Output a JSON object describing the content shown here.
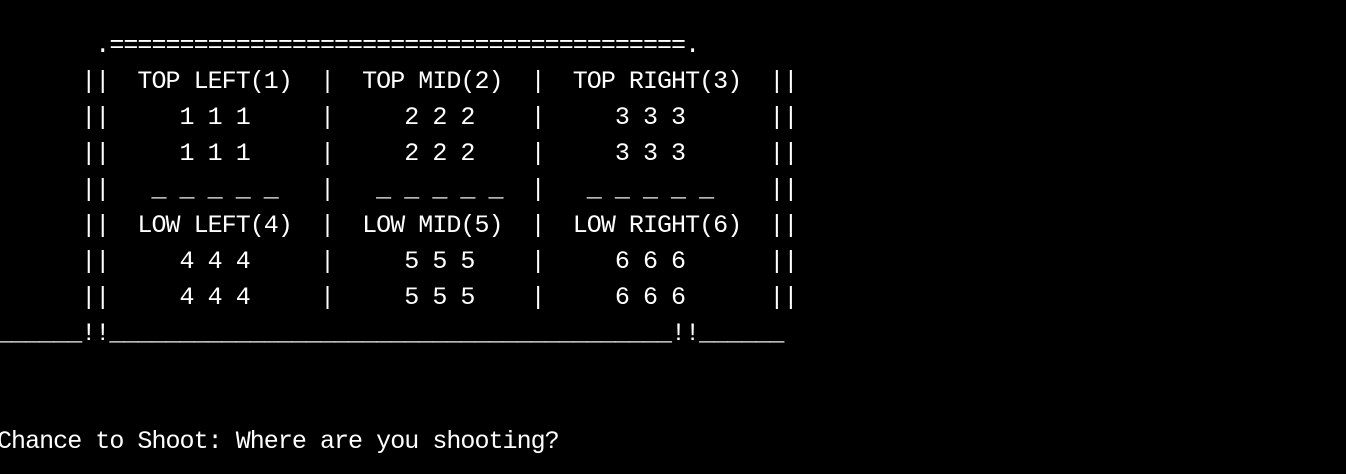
{
  "terminal": {
    "background": "#000000",
    "foreground": "#ffffff",
    "goal_art": [
      "       .=========================================.",
      "      ||  TOP LEFT(1)  |  TOP MID(2)  |  TOP RIGHT(3)  ||",
      "      ||     1 1 1     |     2 2 2    |     3 3 3      ||",
      "      ||     1 1 1     |     2 2 2    |     3 3 3      ||",
      "      ||   _ _ _ _ _   |   _ _ _ _ _  |   _ _ _ _ _    ||",
      "      ||  LOW LEFT(4)  |  LOW MID(5)  |  LOW RIGHT(6)  ||",
      "      ||     4 4 4     |     5 5 5    |     6 6 6      ||",
      "      ||     4 4 4     |     5 5 5    |     6 6 6      ||",
      "______!!________________________________________!!______"
    ],
    "prompt": "Chance to Shoot: Where are you shooting?"
  }
}
